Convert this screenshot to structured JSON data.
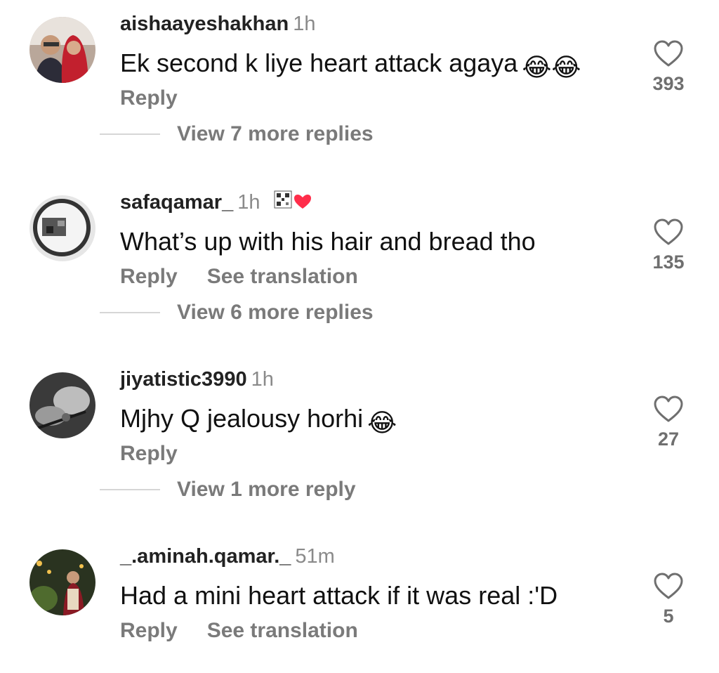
{
  "comments": [
    {
      "username": "aishaayeshakhan",
      "time": "1h",
      "text": "Ek second k liye heart attack agaya",
      "emojis": "😂😂",
      "reply_label": "Reply",
      "likes": "393",
      "view_replies": "View 7 more replies"
    },
    {
      "username": "safaqamar_",
      "time": "1h",
      "text": "What’s up with his hair and bread tho",
      "reply_label": "Reply",
      "translate_label": "See translation",
      "likes": "135",
      "view_replies": "View 6 more replies"
    },
    {
      "username": "jiyatistic3990",
      "time": "1h",
      "text": "Mjhy Q jealousy horhi",
      "emojis": "😂",
      "reply_label": "Reply",
      "likes": "27",
      "view_replies": "View 1 more reply"
    },
    {
      "username": "_.aminah.qamar._",
      "time": "51m",
      "text": "Had a mini heart attack if it was real :'D",
      "reply_label": "Reply",
      "translate_label": "See translation",
      "likes": "5"
    }
  ],
  "colors": {
    "username": "#222222",
    "secondary": "#7a7a7a",
    "badge_heart": "#ff2d4a"
  }
}
